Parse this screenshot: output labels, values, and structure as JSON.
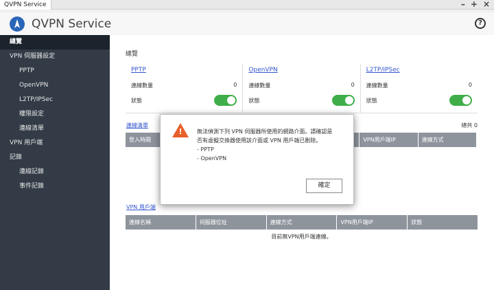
{
  "window": {
    "title": "QVPN Service"
  },
  "header": {
    "app_title": "QVPN Service",
    "help": "?"
  },
  "sidebar": {
    "items": [
      {
        "label": "總覽"
      },
      {
        "label": "VPN 伺服器設定"
      },
      {
        "label": "PPTP"
      },
      {
        "label": "OpenVPN"
      },
      {
        "label": "L2TP/IPSec"
      },
      {
        "label": "權限設定"
      },
      {
        "label": "連線清單"
      },
      {
        "label": "VPN 用戶端"
      },
      {
        "label": "記錄"
      },
      {
        "label": "連線記錄"
      },
      {
        "label": "事件記錄"
      }
    ]
  },
  "main": {
    "section_title": "總覽",
    "servers": [
      {
        "name": "PPTP",
        "conn_label": "連線數量",
        "conn_count": "0",
        "status_label": "狀態"
      },
      {
        "name": "OpenVPN",
        "conn_label": "連線數量",
        "conn_count": "0",
        "status_label": "狀態"
      },
      {
        "name": "L2TP/IPSec",
        "conn_label": "連線數量",
        "conn_count": "0",
        "status_label": "狀態"
      }
    ],
    "connection_list": {
      "link": "連線清單",
      "total": "總共 0",
      "columns": [
        "登入時間",
        "",
        "",
        "",
        "VPN用戶端IP",
        "連線方式"
      ]
    },
    "vpn_client": {
      "link": "VPN 用戶端",
      "columns": [
        "連線名稱",
        "伺服器位址",
        "連線方式",
        "VPN用戶端IP",
        "狀態"
      ],
      "empty": "目前無VPN用戶端連線。"
    }
  },
  "dialog": {
    "line1": "無法偵測下列 VPN 伺服器所使用的網路介面。請確認是",
    "line2": "否有虛擬交換器使用該介面或 VPN 用戶端已刪除。",
    "line3": "- PPTP",
    "line4": "- OpenVPN",
    "ok_label": "確定"
  }
}
